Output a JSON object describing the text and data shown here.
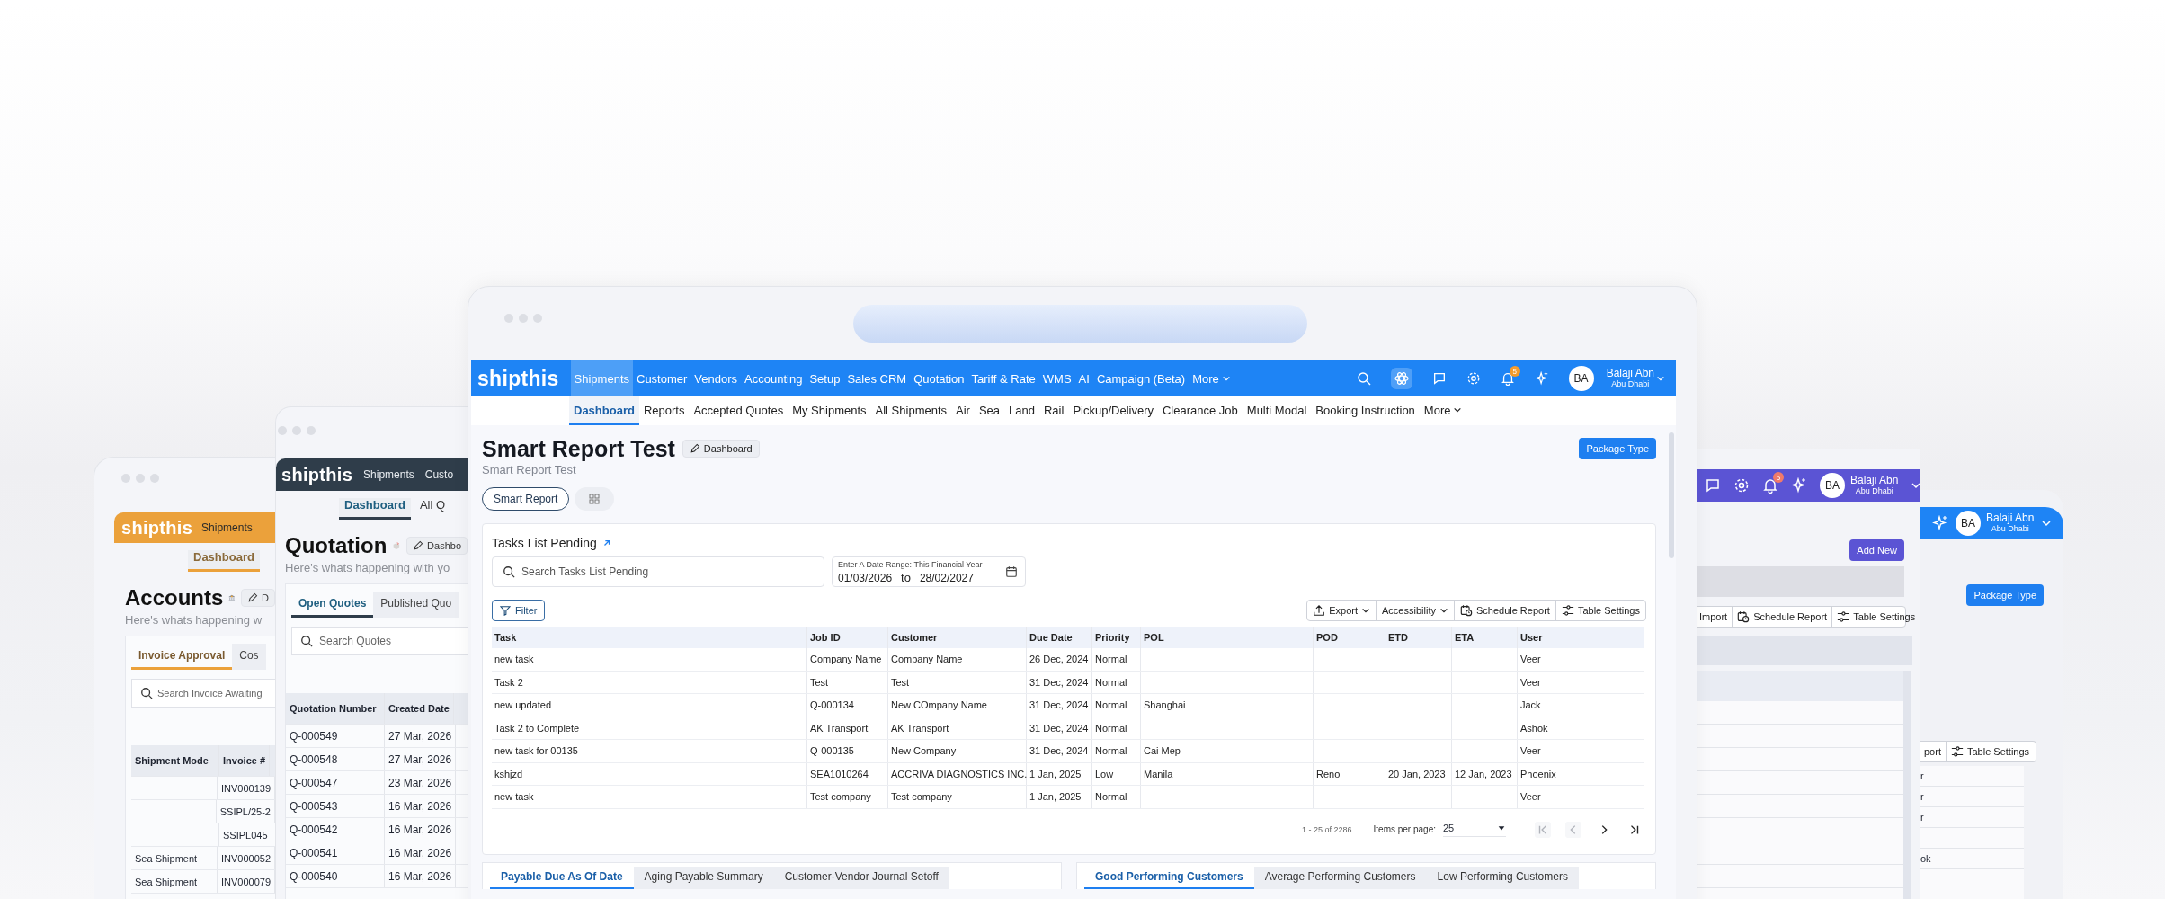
{
  "accounts_window": {
    "logo": "shipthis",
    "nav": [
      "Shipments"
    ],
    "subnav": [
      {
        "label": "Dashboard",
        "selected": true
      }
    ],
    "title": "Accounts",
    "edit_button": "D",
    "subtitle": "Here's whats happening w",
    "tabs": [
      {
        "label": "Invoice Approval",
        "selected": true
      },
      {
        "label": "Cos",
        "selected": false
      }
    ],
    "search": {
      "placeholder": "Search Invoice Awaiting"
    },
    "table": {
      "columns": [
        "Shipment Mode",
        "Invoice #"
      ],
      "rows": [
        {
          "invoice": "INV000139"
        },
        {
          "invoice": "SSIPL/25-2"
        },
        {
          "invoice": "SSIPL045"
        },
        {
          "shipment_mode": "Sea Shipment",
          "invoice": "INV000052"
        },
        {
          "shipment_mode": "Sea Shipment",
          "invoice": "INV000079"
        }
      ]
    }
  },
  "quotation_window": {
    "logo": "shipthis",
    "nav": [
      "Shipments",
      "Custo"
    ],
    "subnav": [
      {
        "label": "Dashboard",
        "selected": true
      },
      {
        "label": "All Q",
        "selected": false
      }
    ],
    "title": "Quotation",
    "edit_button": "Dashbo",
    "subtitle": "Here's whats happening with yo",
    "tabs": [
      {
        "label": "Open Quotes",
        "selected": true
      },
      {
        "label": "Published Quo",
        "selected": false
      }
    ],
    "search": {
      "placeholder": "Search Quotes"
    },
    "table": {
      "columns": [
        "Quotation Number",
        "Created Date"
      ],
      "rows": [
        [
          "Q-000549",
          "27 Mar, 2026"
        ],
        [
          "Q-000548",
          "27 Mar, 2026"
        ],
        [
          "Q-000547",
          "23 Mar, 2026"
        ],
        [
          "Q-000543",
          "16 Mar, 2026"
        ],
        [
          "Q-000542",
          "16 Mar, 2026"
        ],
        [
          "Q-000541",
          "16 Mar, 2026"
        ],
        [
          "Q-000540",
          "16 Mar, 2026"
        ]
      ]
    }
  },
  "main_window": {
    "logo": "shipthis",
    "nav": [
      {
        "label": "Shipments",
        "selected": true
      },
      {
        "label": "Customer",
        "selected": false
      },
      {
        "label": "Vendors",
        "selected": false
      },
      {
        "label": "Accounting",
        "selected": false
      },
      {
        "label": "Setup",
        "selected": false
      },
      {
        "label": "Sales CRM",
        "selected": false
      },
      {
        "label": "Quotation",
        "selected": false
      },
      {
        "label": "Tariff & Rate",
        "selected": false
      },
      {
        "label": "WMS",
        "selected": false
      },
      {
        "label": "AI",
        "selected": false
      },
      {
        "label": "Campaign (Beta)",
        "selected": false
      },
      {
        "label": "More",
        "selected": false
      }
    ],
    "notification_count": "5",
    "user": {
      "initials": "BA",
      "name": "Balaji Abn",
      "location": "Abu Dhabi"
    },
    "subnav": [
      {
        "label": "Dashboard",
        "selected": true
      },
      {
        "label": "Reports",
        "selected": false
      },
      {
        "label": "Accepted Quotes",
        "selected": false
      },
      {
        "label": "My Shipments",
        "selected": false
      },
      {
        "label": "All Shipments",
        "selected": false
      },
      {
        "label": "Air",
        "selected": false
      },
      {
        "label": "Sea",
        "selected": false
      },
      {
        "label": "Land",
        "selected": false
      },
      {
        "label": "Rail",
        "selected": false
      },
      {
        "label": "Pickup/Delivery",
        "selected": false
      },
      {
        "label": "Clearance Job",
        "selected": false
      },
      {
        "label": "Multi Modal",
        "selected": false
      },
      {
        "label": "Booking Instruction",
        "selected": false
      },
      {
        "label": "More",
        "selected": false
      }
    ],
    "page": {
      "title": "Smart Report Test",
      "edit_button": "Dashboard",
      "subtitle": "Smart Report Test",
      "primary_button": "Package Type",
      "views": [
        {
          "kind": "text",
          "label": "Smart Report",
          "selected": true
        },
        {
          "kind": "grid",
          "selected": false
        }
      ]
    },
    "task_card": {
      "title": "Tasks List Pending",
      "search": {
        "placeholder": "Search Tasks List Pending"
      },
      "date_range": {
        "label": "Enter A Date Range: This Financial Year",
        "from": "01/03/2026",
        "separator": "to",
        "to": "28/02/2027"
      },
      "filter_button": "Filter",
      "toolbar": [
        {
          "kind": "export",
          "label": "Export",
          "dropdown": true
        },
        {
          "kind": "plain",
          "label": "Accessibility",
          "dropdown": true
        },
        {
          "kind": "schedule",
          "label": "Schedule Report",
          "dropdown": false
        },
        {
          "kind": "settings",
          "label": "Table Settings",
          "dropdown": false
        }
      ],
      "table": {
        "columns": [
          "Task",
          "Job ID",
          "Customer",
          "Due Date",
          "Priority",
          "POL",
          "POD",
          "ETD",
          "ETA",
          "User"
        ],
        "rows": [
          {
            "task": "new task",
            "job_id": "Company Name",
            "customer": "Company Name",
            "due_date": "26 Dec, 2024",
            "priority": "Normal",
            "user": "Veer"
          },
          {
            "task": "Task 2",
            "job_id": "Test",
            "customer": "Test",
            "due_date": "31 Dec, 2024",
            "priority": "Normal",
            "user": "Veer"
          },
          {
            "task": "new updated",
            "job_id": "Q-000134",
            "customer": "New COmpany Name",
            "due_date": "31 Dec, 2024",
            "priority": "Normal",
            "pol": "Shanghai",
            "user": "Jack"
          },
          {
            "task": "Task 2 to Complete",
            "job_id": "AK Transport",
            "customer": "AK Transport",
            "due_date": "31 Dec, 2024",
            "priority": "Normal",
            "user": "Ashok"
          },
          {
            "task": "new task for 00135",
            "job_id": "Q-000135",
            "customer": "New Company",
            "due_date": "31 Dec, 2024",
            "priority": "Normal",
            "pol": "Cai Mep",
            "user": "Veer"
          },
          {
            "task": "kshjzd",
            "job_id": "SEA1010264",
            "customer": "ACCRIVA DIAGNOSTICS INC.",
            "due_date": "1 Jan, 2025",
            "priority": "Low",
            "pol": "Manila",
            "pod": "Reno",
            "etd": "20 Jan, 2023",
            "eta": "12 Jan, 2023",
            "user": "Phoenix"
          },
          {
            "task": "new task",
            "job_id": "Test company",
            "customer": "Test company",
            "due_date": "1 Jan, 2025",
            "priority": "Normal",
            "user": "Veer"
          }
        ]
      },
      "pagination": {
        "range": "1 - 25 of 2286",
        "items_per_page_label": "Items per page:",
        "items_per_page": "25",
        "buttons": [
          {
            "kind": "first",
            "disabled": true
          },
          {
            "kind": "prev",
            "disabled": true
          },
          {
            "kind": "next",
            "disabled": false
          },
          {
            "kind": "last",
            "disabled": false
          }
        ]
      }
    },
    "bottom_cards": [
      {
        "tabs": [
          {
            "label": "Payable Due As Of Date",
            "selected": true
          },
          {
            "label": "Aging Payable Summary",
            "selected": false
          },
          {
            "label": "Customer-Vendor Journal Setoff",
            "selected": false
          }
        ]
      },
      {
        "tabs": [
          {
            "label": "Good Performing Customers",
            "selected": true
          },
          {
            "label": "Average Performing Customers",
            "selected": false
          },
          {
            "label": "Low Performing Customers",
            "selected": false
          }
        ]
      }
    ]
  },
  "purple_window": {
    "notification_count": "5",
    "user": {
      "initials": "BA",
      "name": "Balaji Abn",
      "location": "Abu Dhabi"
    },
    "add_button": "Add New",
    "toolbar": [
      {
        "kind": "plain",
        "label": "Import"
      },
      {
        "kind": "schedule",
        "label": "Schedule Report"
      },
      {
        "kind": "settings",
        "label": "Table Settings"
      }
    ]
  },
  "blue_window": {
    "user": {
      "initials": "BA",
      "name": "Balaji Abn",
      "location": "Abu Dhabi"
    },
    "primary_button": "Package Type",
    "toolbar": [
      {
        "kind": "plain",
        "label": "port"
      },
      {
        "kind": "settings",
        "label": "Table Settings"
      }
    ],
    "rows": [
      {
        "text": "r"
      },
      {
        "text": "r"
      },
      {
        "text": "r"
      },
      {},
      {
        "text": "ok"
      }
    ]
  }
}
